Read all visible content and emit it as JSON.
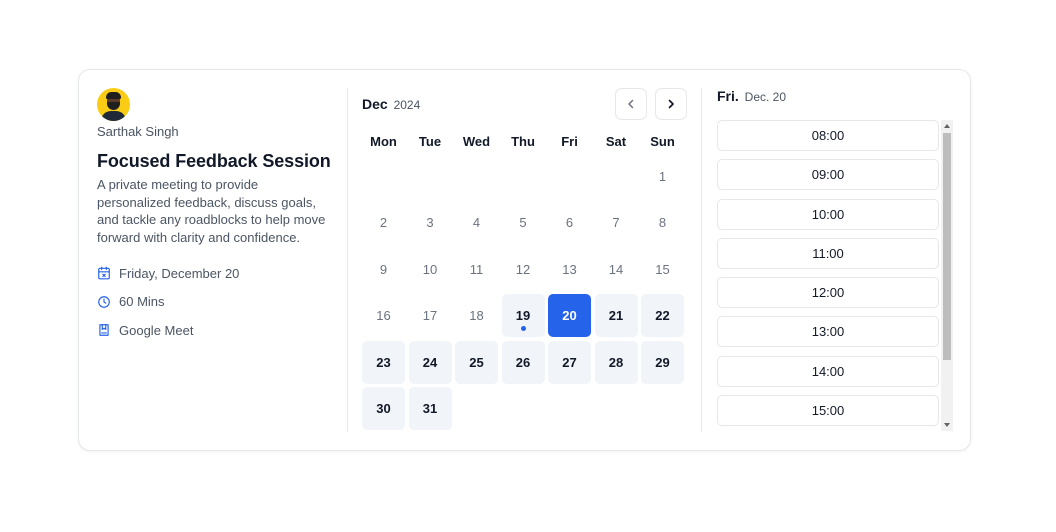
{
  "host": {
    "name": "Sarthak Singh"
  },
  "event": {
    "title": "Focused Feedback Session",
    "description": "A private meeting to provide personalized feedback, discuss goals, and tackle any roadblocks to help move forward with clarity and confidence.",
    "date": "Friday, December 20",
    "duration": "60 Mins",
    "location": "Google Meet"
  },
  "calendar": {
    "month": "Dec",
    "year": "2024",
    "weekdays": [
      "Mon",
      "Tue",
      "Wed",
      "Thu",
      "Fri",
      "Sat",
      "Sun"
    ],
    "leading_blanks": 6,
    "days": [
      {
        "n": "1",
        "state": "past"
      },
      {
        "n": "2",
        "state": "past"
      },
      {
        "n": "3",
        "state": "past"
      },
      {
        "n": "4",
        "state": "past"
      },
      {
        "n": "5",
        "state": "past"
      },
      {
        "n": "6",
        "state": "past"
      },
      {
        "n": "7",
        "state": "past"
      },
      {
        "n": "8",
        "state": "past"
      },
      {
        "n": "9",
        "state": "past"
      },
      {
        "n": "10",
        "state": "past"
      },
      {
        "n": "11",
        "state": "past"
      },
      {
        "n": "12",
        "state": "past"
      },
      {
        "n": "13",
        "state": "past"
      },
      {
        "n": "14",
        "state": "past"
      },
      {
        "n": "15",
        "state": "past"
      },
      {
        "n": "16",
        "state": "past"
      },
      {
        "n": "17",
        "state": "past"
      },
      {
        "n": "18",
        "state": "past"
      },
      {
        "n": "19",
        "state": "available",
        "today": true
      },
      {
        "n": "20",
        "state": "selected"
      },
      {
        "n": "21",
        "state": "available"
      },
      {
        "n": "22",
        "state": "available"
      },
      {
        "n": "23",
        "state": "available"
      },
      {
        "n": "24",
        "state": "available"
      },
      {
        "n": "25",
        "state": "available"
      },
      {
        "n": "26",
        "state": "available"
      },
      {
        "n": "27",
        "state": "available"
      },
      {
        "n": "28",
        "state": "available"
      },
      {
        "n": "29",
        "state": "available"
      },
      {
        "n": "30",
        "state": "available"
      },
      {
        "n": "31",
        "state": "available"
      }
    ]
  },
  "slots": {
    "day": "Fri.",
    "date": "Dec. 20",
    "times": [
      "08:00",
      "09:00",
      "10:00",
      "11:00",
      "12:00",
      "13:00",
      "14:00",
      "15:00"
    ]
  },
  "colors": {
    "accent": "#2563eb",
    "available_bg": "#f1f5f9",
    "border": "#e5e7eb",
    "muted_text": "#4b5563"
  },
  "icons": {
    "date": "calendar-x-icon",
    "duration": "clock-icon",
    "location": "book-icon",
    "prev": "chevron-left-icon",
    "next": "chevron-right-icon"
  }
}
